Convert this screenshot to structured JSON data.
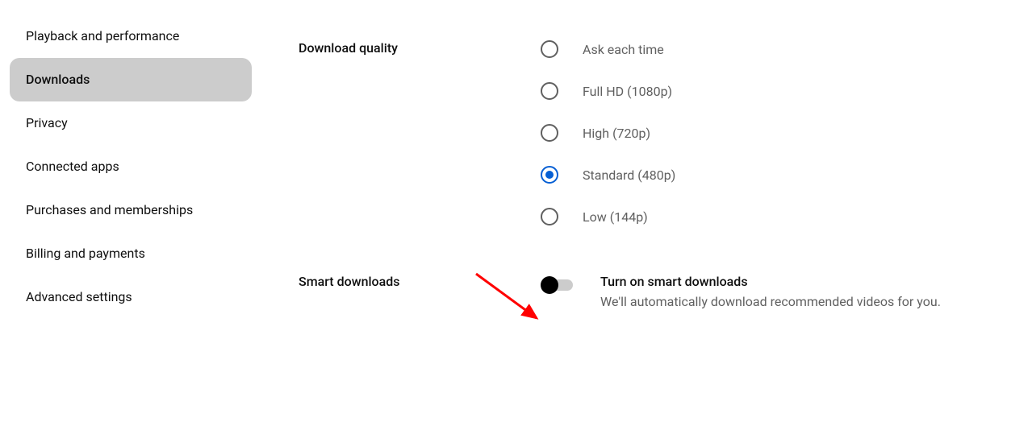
{
  "sidebar": {
    "items": [
      {
        "label": "Playback and performance",
        "active": false
      },
      {
        "label": "Downloads",
        "active": true
      },
      {
        "label": "Privacy",
        "active": false
      },
      {
        "label": "Connected apps",
        "active": false
      },
      {
        "label": "Purchases and memberships",
        "active": false
      },
      {
        "label": "Billing and payments",
        "active": false
      },
      {
        "label": "Advanced settings",
        "active": false
      }
    ]
  },
  "download_quality": {
    "heading": "Download quality",
    "options": [
      {
        "label": "Ask each time",
        "selected": false
      },
      {
        "label": "Full HD (1080p)",
        "selected": false
      },
      {
        "label": "High (720p)",
        "selected": false
      },
      {
        "label": "Standard (480p)",
        "selected": true
      },
      {
        "label": "Low (144p)",
        "selected": false
      }
    ]
  },
  "smart_downloads": {
    "heading": "Smart downloads",
    "title": "Turn on smart downloads",
    "description": "We'll automatically download recommended videos for you.",
    "enabled": false
  }
}
